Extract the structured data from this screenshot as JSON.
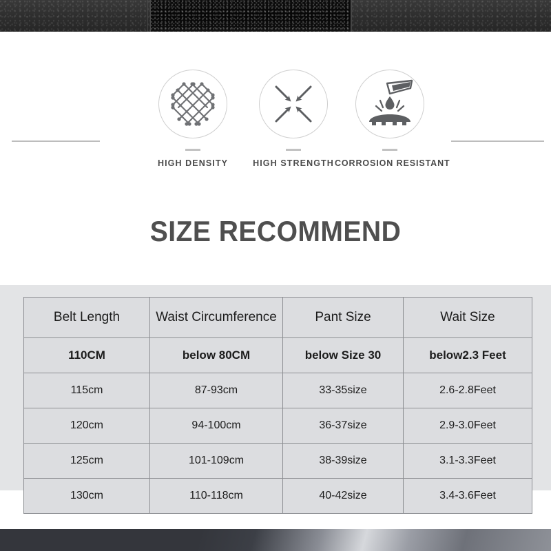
{
  "banner": {
    "top_strip_name": "black-textured-belt-photo",
    "bottom_strip_name": "metallic-buckle-photo"
  },
  "features": {
    "items": [
      {
        "icon": "mesh-lattice-icon",
        "label": "HIGH DENSITY"
      },
      {
        "icon": "converging-arrows-icon",
        "label": "HIGH STRENGTH"
      },
      {
        "icon": "corrosion-droplet-icon",
        "label": "CORROSION RESISTANT"
      }
    ]
  },
  "title": "SIZE RECOMMEND",
  "table": {
    "headers": [
      "Belt Length",
      "Waist Circumference",
      "Pant Size",
      "Wait Size"
    ],
    "rows": [
      [
        "110CM",
        "below 80CM",
        "below Size 30",
        "below2.3 Feet"
      ],
      [
        "115cm",
        "87-93cm",
        "33-35size",
        "2.6-2.8Feet"
      ],
      [
        "120cm",
        "94-100cm",
        "36-37size",
        "2.9-3.0Feet"
      ],
      [
        "125cm",
        "101-109cm",
        "38-39size",
        "3.1-3.3Feet"
      ],
      [
        "130cm",
        "110-118cm",
        "40-42size",
        "3.4-3.6Feet"
      ]
    ]
  },
  "colors": {
    "panel_bg": "#e3e4e6",
    "cell_bg": "#dcdde0",
    "cell_border": "#8d8f93",
    "title_text": "#4f4f4f",
    "icon_stroke": "#6f7174",
    "deco_line": "#bdbdbd"
  }
}
